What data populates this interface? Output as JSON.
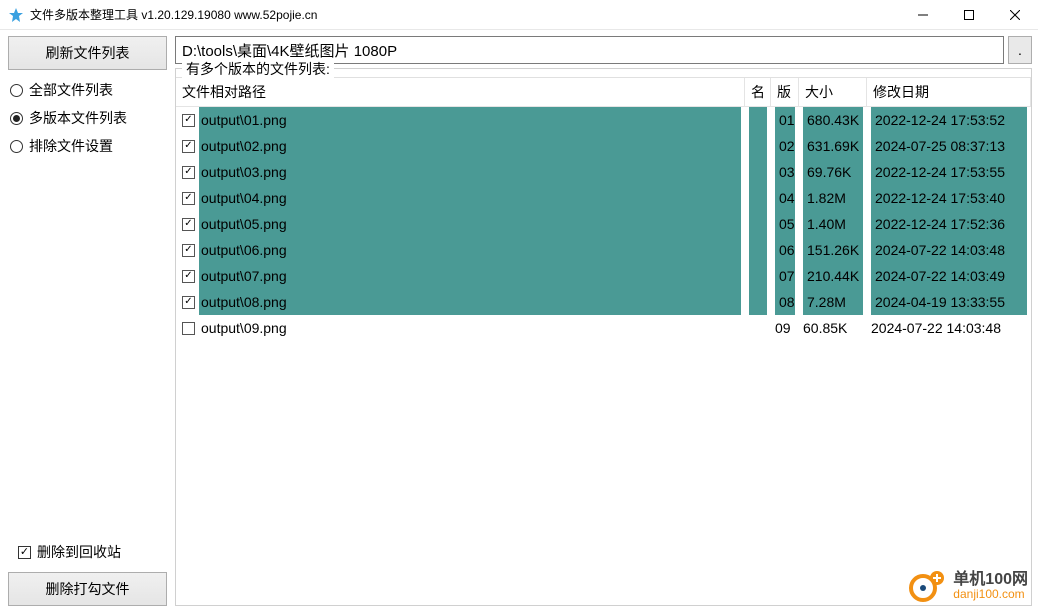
{
  "window": {
    "title": "文件多版本整理工具 v1.20.129.19080 www.52pojie.cn"
  },
  "sidebar": {
    "refresh_btn": "刷新文件列表",
    "radios": [
      {
        "label": "全部文件列表",
        "checked": false
      },
      {
        "label": "多版本文件列表",
        "checked": true
      },
      {
        "label": "排除文件设置",
        "checked": false
      }
    ],
    "recycle_check": {
      "label": "删除到回收站",
      "checked": true
    },
    "delete_btn": "删除打勾文件"
  },
  "content": {
    "path": "D:\\tools\\桌面\\4K壁纸图片 1080P",
    "browse_btn": ".",
    "group_label": "有多个版本的文件列表:",
    "columns": {
      "path": "文件相对路径",
      "name": "名",
      "ver": "版",
      "size": "大小",
      "date": "修改日期"
    },
    "rows": [
      {
        "checked": true,
        "hl": true,
        "path": "output\\01.png",
        "ver": "01",
        "size": "680.43K",
        "date": "2022-12-24 17:53:52"
      },
      {
        "checked": true,
        "hl": true,
        "path": "output\\02.png",
        "ver": "02",
        "size": "631.69K",
        "date": "2024-07-25 08:37:13"
      },
      {
        "checked": true,
        "hl": true,
        "path": "output\\03.png",
        "ver": "03",
        "size": "69.76K",
        "date": "2022-12-24 17:53:55"
      },
      {
        "checked": true,
        "hl": true,
        "path": "output\\04.png",
        "ver": "04",
        "size": "1.82M",
        "date": "2022-12-24 17:53:40"
      },
      {
        "checked": true,
        "hl": true,
        "path": "output\\05.png",
        "ver": "05",
        "size": "1.40M",
        "date": "2022-12-24 17:52:36"
      },
      {
        "checked": true,
        "hl": true,
        "path": "output\\06.png",
        "ver": "06",
        "size": "151.26K",
        "date": "2024-07-22 14:03:48"
      },
      {
        "checked": true,
        "hl": true,
        "path": "output\\07.png",
        "ver": "07",
        "size": "210.44K",
        "date": "2024-07-22 14:03:49"
      },
      {
        "checked": true,
        "hl": true,
        "path": "output\\08.png",
        "ver": "08",
        "size": "7.28M",
        "date": "2024-04-19 13:33:55"
      },
      {
        "checked": false,
        "hl": false,
        "path": "output\\09.png",
        "ver": "09",
        "size": "60.85K",
        "date": "2024-07-22 14:03:48"
      }
    ]
  },
  "watermark": {
    "line1": "单机100网",
    "line2": "danji100.com"
  }
}
